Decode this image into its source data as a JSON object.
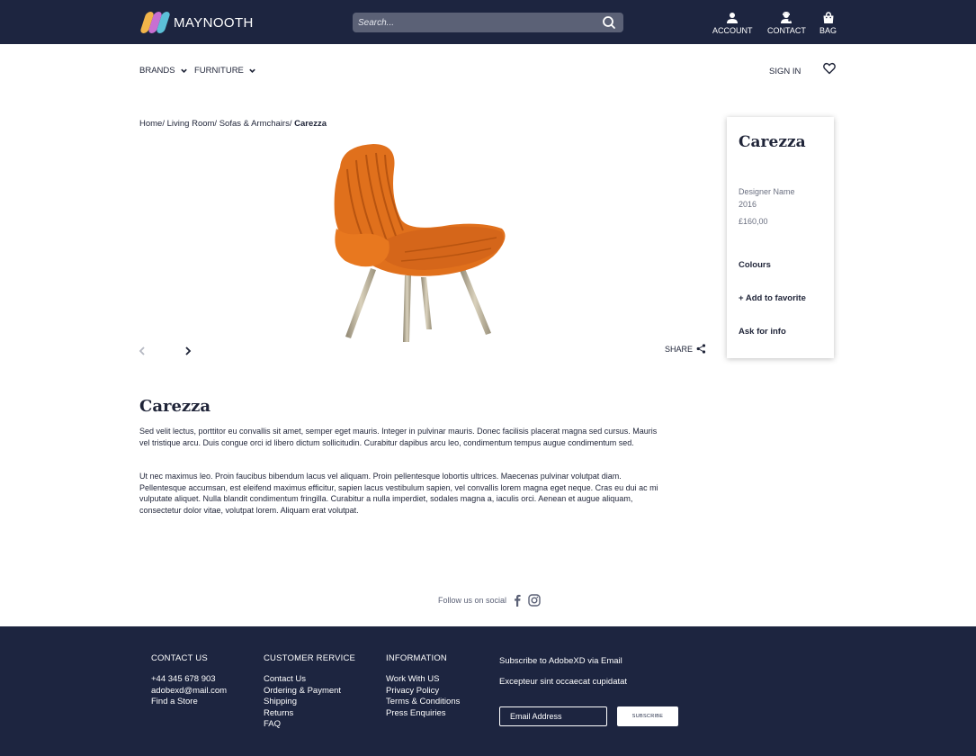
{
  "header": {
    "logo_text": "MAYNOOTH",
    "search_placeholder": "Search...",
    "actions": [
      {
        "label": "ACCOUNT",
        "icon": "account-icon"
      },
      {
        "label": "CONTACT",
        "icon": "contact-icon"
      },
      {
        "label": "BAG",
        "icon": "bag-icon"
      }
    ]
  },
  "subnav": {
    "brands": "BRANDS",
    "furniture": "FURNITURE",
    "sign_in": "SIGN IN"
  },
  "breadcrumb": {
    "path": "Home/ Living Room/ Sofas & Armchairs/ ",
    "current": "Carezza"
  },
  "gallery": {
    "share": "SHARE"
  },
  "product": {
    "name": "Carezza",
    "designer": "Designer Name",
    "year": "2016",
    "price": "£160,00",
    "colours": "Colours",
    "add_favorite": "+ Add to favorite",
    "ask_info": "Ask for info"
  },
  "description": {
    "title": "Carezza",
    "p1": "Sed velit lectus, porttitor eu convallis sit amet, semper eget mauris. Integer in pulvinar mauris. Donec facilisis placerat magna sed cursus. Mauris vel tristique arcu. Duis congue orci id libero dictum sollicitudin. Curabitur dapibus arcu leo, condimentum tempus augue condimentum sed.",
    "p2": "Ut nec maximus leo. Proin faucibus bibendum lacus vel aliquam. Proin pellentesque lobortis ultrices. Maecenas pulvinar volutpat diam. Pellentesque accumsan, est eleifend maximus efficitur, sapien lacus vestibulum sapien, vel convallis lorem magna eget neque. Cras eu dui ac mi vulputate aliquet. Nulla blandit condimentum fringilla. Curabitur a nulla imperdiet, sodales magna a, iaculis orci. Aenean et augue aliquam, consectetur dolor vitae, volutpat lorem. Aliquam erat volutpat."
  },
  "social": {
    "label": "Follow us on social"
  },
  "footer": {
    "contact": {
      "heading": "CONTACT US",
      "items": [
        "+44 345 678 903",
        "adobexd@mail.com",
        "Find a Store"
      ]
    },
    "customer": {
      "heading": "CUSTOMER RERVICE",
      "items": [
        "Contact Us",
        "Ordering & Payment",
        "Shipping",
        "Returns",
        "FAQ"
      ]
    },
    "information": {
      "heading": "INFORMATION",
      "items": [
        "Work With US",
        "Privacy Policy",
        "Terms & Conditions",
        "Press Enquiries"
      ]
    },
    "subscribe_title": "Subscribe to AdobeXD via Email",
    "subscribe_text": "Excepteur sint occaecat cupidatat",
    "email_placeholder": "Email Address",
    "subscribe_button": "SUBSCRIBE"
  },
  "colors": {
    "navy": "#1d2540",
    "search_bg": "#5b6176",
    "chair_orange": "#e0701c"
  }
}
